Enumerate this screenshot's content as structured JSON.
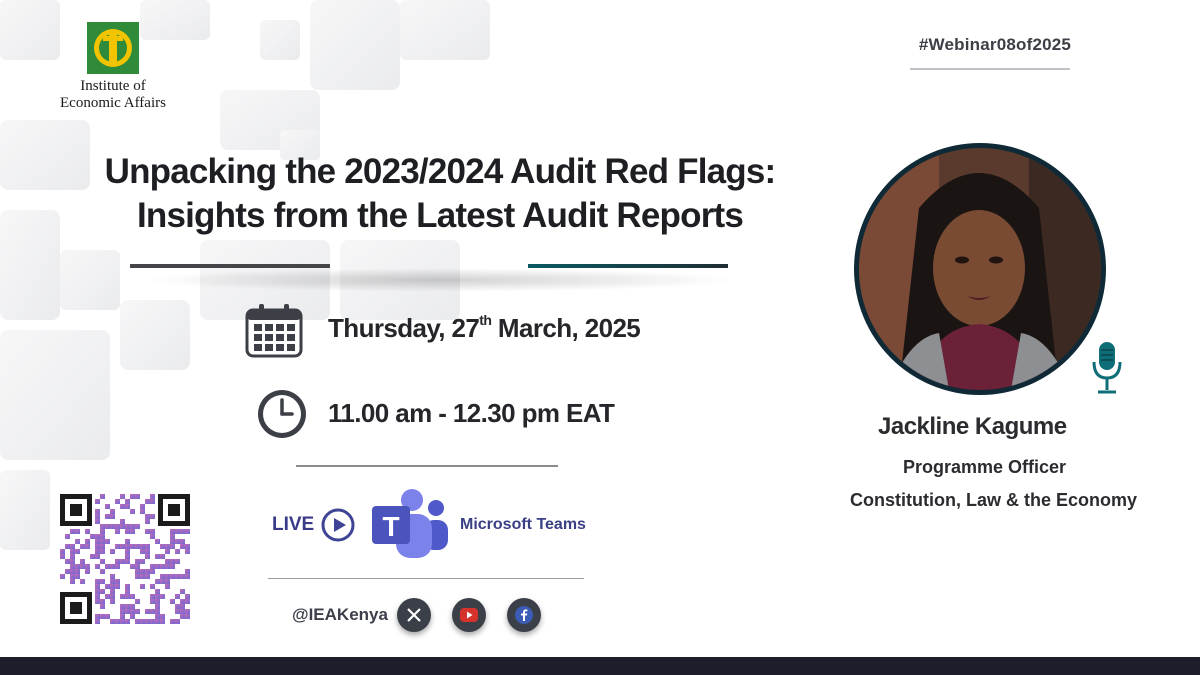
{
  "organization": {
    "logo_line1": "Institute of",
    "logo_line2": "Economic Affairs",
    "logo_colors": {
      "green": "#2f8a3a",
      "yellow": "#f2c400"
    }
  },
  "hashtag": "#Webinar08of2025",
  "title": {
    "line1": "Unpacking the 2023/2024 Audit Red Flags:",
    "line2": "Insights from the Latest Audit Reports"
  },
  "event": {
    "date_prefix": "Thursday, 27",
    "date_sup": "th",
    "date_suffix": " March, 2025",
    "time": "11.00 am - 12.30 pm EAT",
    "date_icon": "calendar-icon",
    "time_icon": "clock-icon"
  },
  "platform": {
    "live_label": "LIVE",
    "name": "Microsoft Teams",
    "icons": [
      "play-icon",
      "microsoft-teams-icon"
    ]
  },
  "social": {
    "handle": "@IEAKenya",
    "icons": [
      "x-icon",
      "youtube-icon",
      "facebook-icon"
    ]
  },
  "speaker": {
    "name": "Jackline Kagume",
    "role": "Programme Officer",
    "department": "Constitution, Law & the Economy",
    "icon": "microphone-icon"
  },
  "colors": {
    "title_text": "#1d1f22",
    "accent_teal": "#0b5a62",
    "teams_purple": "#4b53bc",
    "footer": "#1c1f2b"
  }
}
